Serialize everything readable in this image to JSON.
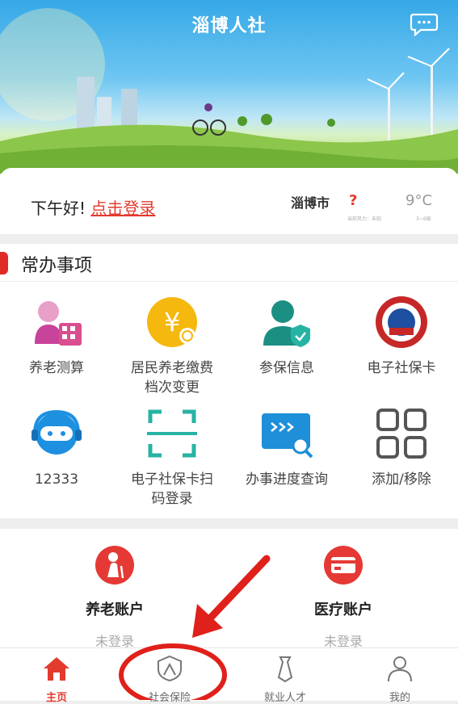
{
  "header": {
    "title": "淄博人社"
  },
  "greeting": {
    "hello": "下午好!",
    "login_link": "点击登录",
    "city": "淄博市",
    "weather_unknown": "?",
    "temperature": "9°C",
    "sub_left": "当前风力：未知",
    "sub_right": "3~6级"
  },
  "services": {
    "title": "常办事项",
    "items": [
      {
        "label": "养老测算"
      },
      {
        "label": "居民养老缴费\n档次变更"
      },
      {
        "label": "参保信息"
      },
      {
        "label": "电子社保卡"
      },
      {
        "label": "12333"
      },
      {
        "label": "电子社保卡扫\n码登录"
      },
      {
        "label": "办事进度查询"
      },
      {
        "label": "添加/移除"
      }
    ]
  },
  "accounts": [
    {
      "name": "养老账户",
      "status": "未登录"
    },
    {
      "name": "医疗账户",
      "status": "未登录"
    }
  ],
  "tabbar": [
    {
      "label": "主页"
    },
    {
      "label": "社会保险"
    },
    {
      "label": "就业人才"
    },
    {
      "label": "我的"
    }
  ],
  "colors": {
    "accent": "#e33a2e",
    "brand_red": "#e02a24",
    "highlight_circle": "#e0201a"
  }
}
